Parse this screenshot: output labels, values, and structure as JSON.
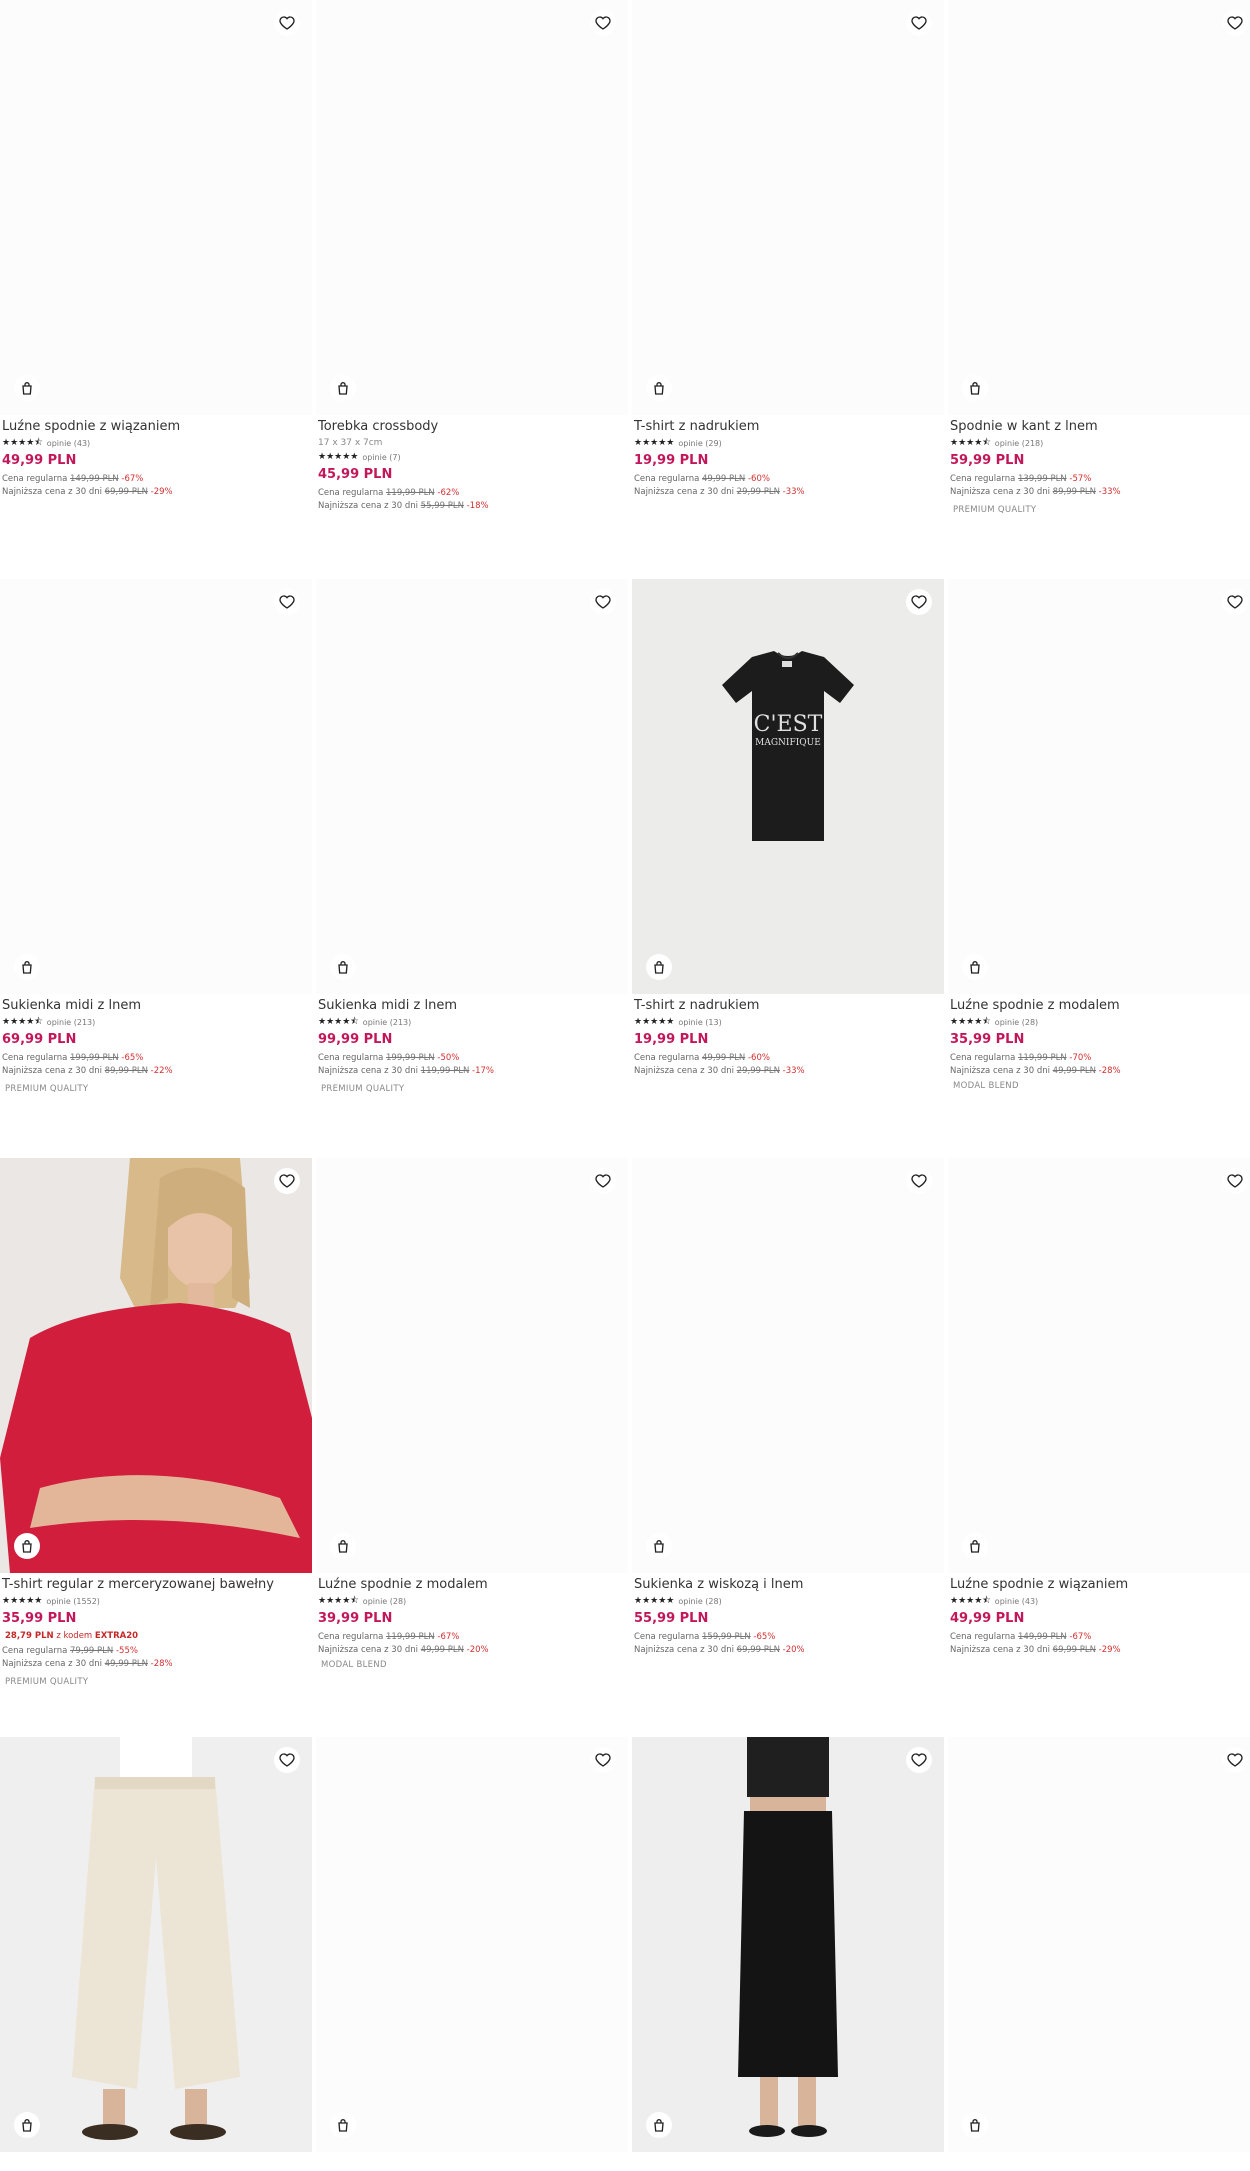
{
  "ui": {
    "heart_icon": "heart-icon",
    "bag_icon": "bag-icon",
    "reviews_prefix": "opinie",
    "regular_label": "Cena regularna",
    "lowest_label": "Najniższa cena z 30 dni"
  },
  "products": [
    {
      "name": "Luźne spodnie z wiązaniem",
      "stars": "★★★★⯪",
      "reviews": "opinie (43)",
      "price": "49,99 PLN",
      "regular": "149,99 PLN",
      "regular_pct": "-67%",
      "lowest": "69,99 PLN",
      "lowest_pct": "-29%"
    },
    {
      "name": "Torebka crossbody",
      "sub": "17 x 37 x 7cm",
      "stars": "★★★★★",
      "reviews": "opinie (7)",
      "price": "45,99 PLN",
      "regular": "119,99 PLN",
      "regular_pct": "-62%",
      "lowest": "55,99 PLN",
      "lowest_pct": "-18%"
    },
    {
      "name": "T-shirt z nadrukiem",
      "stars": "★★★★★",
      "reviews": "opinie (29)",
      "price": "19,99 PLN",
      "regular": "49,99 PLN",
      "regular_pct": "-60%",
      "lowest": "29,99 PLN",
      "lowest_pct": "-33%"
    },
    {
      "name": "Spodnie w kant z lnem",
      "stars": "★★★★⯪",
      "reviews": "opinie (218)",
      "price": "59,99 PLN",
      "regular": "139,99 PLN",
      "regular_pct": "-57%",
      "lowest": "89,99 PLN",
      "lowest_pct": "-33%",
      "tag": "PREMIUM QUALITY"
    },
    {
      "name": "Sukienka midi z lnem",
      "stars": "★★★★⯪",
      "reviews": "opinie (213)",
      "price": "69,99 PLN",
      "regular": "199,99 PLN",
      "regular_pct": "-65%",
      "lowest": "89,99 PLN",
      "lowest_pct": "-22%",
      "tag": "PREMIUM QUALITY"
    },
    {
      "name": "Sukienka midi z lnem",
      "stars": "★★★★⯪",
      "reviews": "opinie (213)",
      "price": "99,99 PLN",
      "regular": "199,99 PLN",
      "regular_pct": "-50%",
      "lowest": "119,99 PLN",
      "lowest_pct": "-17%",
      "tag": "PREMIUM QUALITY"
    },
    {
      "name": "T-shirt z nadrukiem",
      "stars": "★★★★★",
      "reviews": "opinie (13)",
      "price": "19,99 PLN",
      "regular": "49,99 PLN",
      "regular_pct": "-60%",
      "lowest": "29,99 PLN",
      "lowest_pct": "-33%",
      "print_line1": "C'EST",
      "print_line2": "MAGNIFIQUE"
    },
    {
      "name": "Luźne spodnie z modalem",
      "stars": "★★★★⯪",
      "reviews": "opinie (28)",
      "price": "35,99 PLN",
      "regular": "119,99 PLN",
      "regular_pct": "-70%",
      "lowest": "49,99 PLN",
      "lowest_pct": "-28%",
      "tag": "MODAL BLEND"
    },
    {
      "name": "T-shirt regular z merceryzowanej bawełny",
      "stars": "★★★★★",
      "reviews": "opinie (1552)",
      "price": "35,99 PLN",
      "promo_price": "28,79 PLN",
      "promo_text": "z kodem",
      "promo_code": "EXTRA20",
      "regular": "79,99 PLN",
      "regular_pct": "-55%",
      "lowest": "49,99 PLN",
      "lowest_pct": "-28%",
      "tag": "PREMIUM QUALITY"
    },
    {
      "name": "Luźne spodnie z modalem",
      "stars": "★★★★⯪",
      "reviews": "opinie (28)",
      "price": "39,99 PLN",
      "regular": "119,99 PLN",
      "regular_pct": "-67%",
      "lowest": "49,99 PLN",
      "lowest_pct": "-20%",
      "tag": "MODAL BLEND"
    },
    {
      "name": "Sukienka z wiskozą i lnem",
      "stars": "★★★★★",
      "reviews": "opinie (28)",
      "price": "55,99 PLN",
      "regular": "159,99 PLN",
      "regular_pct": "-65%",
      "lowest": "69,99 PLN",
      "lowest_pct": "-20%"
    },
    {
      "name": "Luźne spodnie z wiązaniem",
      "stars": "★★★★⯪",
      "reviews": "opinie (43)",
      "price": "49,99 PLN",
      "regular": "149,99 PLN",
      "regular_pct": "-67%",
      "lowest": "69,99 PLN",
      "lowest_pct": "-29%"
    }
  ]
}
